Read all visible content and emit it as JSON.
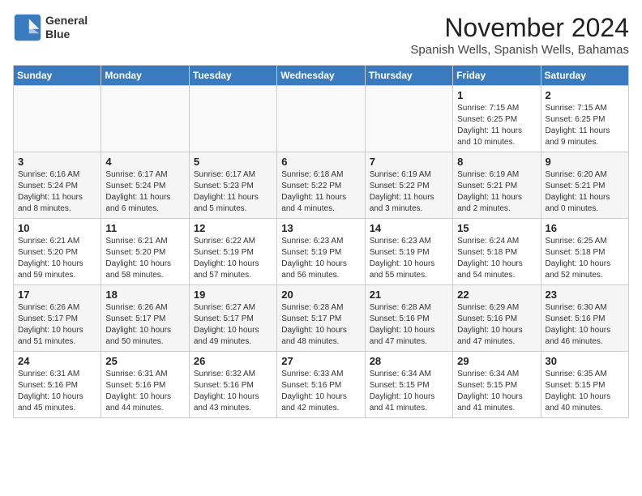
{
  "header": {
    "logo_line1": "General",
    "logo_line2": "Blue",
    "month": "November 2024",
    "location": "Spanish Wells, Spanish Wells, Bahamas"
  },
  "days_of_week": [
    "Sunday",
    "Monday",
    "Tuesday",
    "Wednesday",
    "Thursday",
    "Friday",
    "Saturday"
  ],
  "weeks": [
    [
      {
        "num": "",
        "info": ""
      },
      {
        "num": "",
        "info": ""
      },
      {
        "num": "",
        "info": ""
      },
      {
        "num": "",
        "info": ""
      },
      {
        "num": "",
        "info": ""
      },
      {
        "num": "1",
        "info": "Sunrise: 7:15 AM\nSunset: 6:25 PM\nDaylight: 11 hours and 10 minutes."
      },
      {
        "num": "2",
        "info": "Sunrise: 7:15 AM\nSunset: 6:25 PM\nDaylight: 11 hours and 9 minutes."
      }
    ],
    [
      {
        "num": "3",
        "info": "Sunrise: 6:16 AM\nSunset: 5:24 PM\nDaylight: 11 hours and 8 minutes."
      },
      {
        "num": "4",
        "info": "Sunrise: 6:17 AM\nSunset: 5:24 PM\nDaylight: 11 hours and 6 minutes."
      },
      {
        "num": "5",
        "info": "Sunrise: 6:17 AM\nSunset: 5:23 PM\nDaylight: 11 hours and 5 minutes."
      },
      {
        "num": "6",
        "info": "Sunrise: 6:18 AM\nSunset: 5:22 PM\nDaylight: 11 hours and 4 minutes."
      },
      {
        "num": "7",
        "info": "Sunrise: 6:19 AM\nSunset: 5:22 PM\nDaylight: 11 hours and 3 minutes."
      },
      {
        "num": "8",
        "info": "Sunrise: 6:19 AM\nSunset: 5:21 PM\nDaylight: 11 hours and 2 minutes."
      },
      {
        "num": "9",
        "info": "Sunrise: 6:20 AM\nSunset: 5:21 PM\nDaylight: 11 hours and 0 minutes."
      }
    ],
    [
      {
        "num": "10",
        "info": "Sunrise: 6:21 AM\nSunset: 5:20 PM\nDaylight: 10 hours and 59 minutes."
      },
      {
        "num": "11",
        "info": "Sunrise: 6:21 AM\nSunset: 5:20 PM\nDaylight: 10 hours and 58 minutes."
      },
      {
        "num": "12",
        "info": "Sunrise: 6:22 AM\nSunset: 5:19 PM\nDaylight: 10 hours and 57 minutes."
      },
      {
        "num": "13",
        "info": "Sunrise: 6:23 AM\nSunset: 5:19 PM\nDaylight: 10 hours and 56 minutes."
      },
      {
        "num": "14",
        "info": "Sunrise: 6:23 AM\nSunset: 5:19 PM\nDaylight: 10 hours and 55 minutes."
      },
      {
        "num": "15",
        "info": "Sunrise: 6:24 AM\nSunset: 5:18 PM\nDaylight: 10 hours and 54 minutes."
      },
      {
        "num": "16",
        "info": "Sunrise: 6:25 AM\nSunset: 5:18 PM\nDaylight: 10 hours and 52 minutes."
      }
    ],
    [
      {
        "num": "17",
        "info": "Sunrise: 6:26 AM\nSunset: 5:17 PM\nDaylight: 10 hours and 51 minutes."
      },
      {
        "num": "18",
        "info": "Sunrise: 6:26 AM\nSunset: 5:17 PM\nDaylight: 10 hours and 50 minutes."
      },
      {
        "num": "19",
        "info": "Sunrise: 6:27 AM\nSunset: 5:17 PM\nDaylight: 10 hours and 49 minutes."
      },
      {
        "num": "20",
        "info": "Sunrise: 6:28 AM\nSunset: 5:17 PM\nDaylight: 10 hours and 48 minutes."
      },
      {
        "num": "21",
        "info": "Sunrise: 6:28 AM\nSunset: 5:16 PM\nDaylight: 10 hours and 47 minutes."
      },
      {
        "num": "22",
        "info": "Sunrise: 6:29 AM\nSunset: 5:16 PM\nDaylight: 10 hours and 47 minutes."
      },
      {
        "num": "23",
        "info": "Sunrise: 6:30 AM\nSunset: 5:16 PM\nDaylight: 10 hours and 46 minutes."
      }
    ],
    [
      {
        "num": "24",
        "info": "Sunrise: 6:31 AM\nSunset: 5:16 PM\nDaylight: 10 hours and 45 minutes."
      },
      {
        "num": "25",
        "info": "Sunrise: 6:31 AM\nSunset: 5:16 PM\nDaylight: 10 hours and 44 minutes."
      },
      {
        "num": "26",
        "info": "Sunrise: 6:32 AM\nSunset: 5:16 PM\nDaylight: 10 hours and 43 minutes."
      },
      {
        "num": "27",
        "info": "Sunrise: 6:33 AM\nSunset: 5:16 PM\nDaylight: 10 hours and 42 minutes."
      },
      {
        "num": "28",
        "info": "Sunrise: 6:34 AM\nSunset: 5:15 PM\nDaylight: 10 hours and 41 minutes."
      },
      {
        "num": "29",
        "info": "Sunrise: 6:34 AM\nSunset: 5:15 PM\nDaylight: 10 hours and 41 minutes."
      },
      {
        "num": "30",
        "info": "Sunrise: 6:35 AM\nSunset: 5:15 PM\nDaylight: 10 hours and 40 minutes."
      }
    ]
  ]
}
